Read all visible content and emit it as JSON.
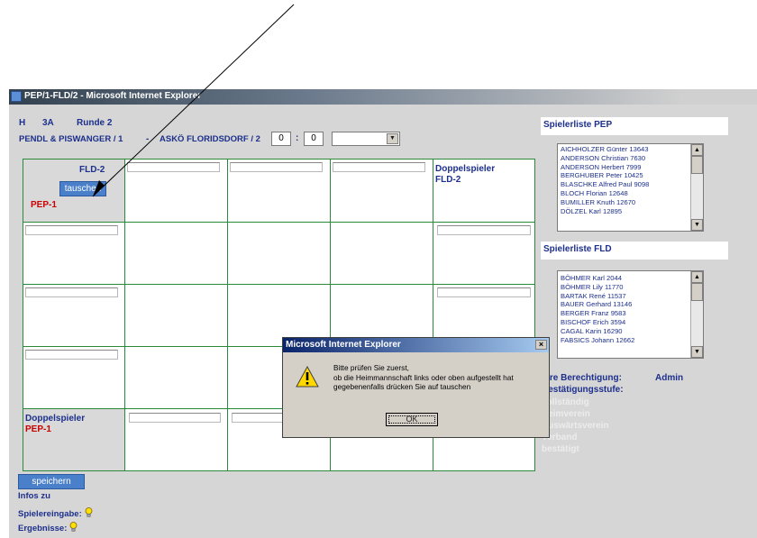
{
  "window": {
    "title": "PEP/1-FLD/2 - Microsoft Internet Explorer"
  },
  "header": {
    "line1_left": "H",
    "line1_class": "3A",
    "line1_round": "Runde 2",
    "home_team": "PENDL & PISWANGER / 1",
    "separator": "-",
    "away_team": "ASKÖ FLORIDSDORF / 2",
    "score_home": "0",
    "score_colon": ":",
    "score_away": "0",
    "select_value": ""
  },
  "grid": {
    "corner_top": "FLD-2",
    "swap_button": "tauschen",
    "corner_bottom": "PEP-1",
    "doubles_right_title": "Doppelspieler",
    "doubles_right_team": "FLD-2",
    "doubles_bottom_title": "Doppelspieler",
    "doubles_bottom_team": "PEP-1"
  },
  "footer": {
    "save_button": "speichern",
    "infos": "Infos zu",
    "player_entry": "Spielereingabe:",
    "results": "Ergebnisse:"
  },
  "right_panel": {
    "pep_title": "Spielerliste PEP",
    "pep_players": [
      "AICHHOLZER Günter 13643",
      "ANDERSON Christian 7630",
      "ANDERSON Herbert 7999",
      "BERGHUBER Peter 10425",
      "BLASCHKE Alfred Paul 9098",
      "BLOCH Florian 12648",
      "BUMILLER Knuth 12670",
      "DÖLZEL Karl 12895"
    ],
    "fld_title": "Spielerliste FLD",
    "fld_players": [
      "BÖHMER Karl 2044",
      "BÖHMER Lily 11770",
      "BARTAK René 11537",
      "BAUER Gerhard 13146",
      "BERGER Franz 9583",
      "BISCHOF Erich 3594",
      "CAGAL Karin 16290",
      "FABSICS Johann 12662"
    ],
    "rights_label": "Ihre Berechtigung:",
    "rights_value": "Admin",
    "confirm_label": "Bestätigungsstufe:",
    "confirm_levels": [
      "vollständig",
      "Heimverein",
      "Auswärtsverein",
      "Verband",
      "bestätigt"
    ]
  },
  "dialog": {
    "title": "Microsoft Internet Explorer",
    "close": "×",
    "line1": "Bitte prüfen Sie zuerst,",
    "line2": "ob die Heimmannschaft links oder oben aufgestellt hat",
    "line3": "gegebenenfalls drücken Sie auf tauschen",
    "ok": "OK"
  },
  "colors": {
    "label_blue": "#1c2f8c",
    "label_red": "#cc0000",
    "grid_green": "#2a8a3a",
    "button_blue": "#4a7fc9"
  }
}
